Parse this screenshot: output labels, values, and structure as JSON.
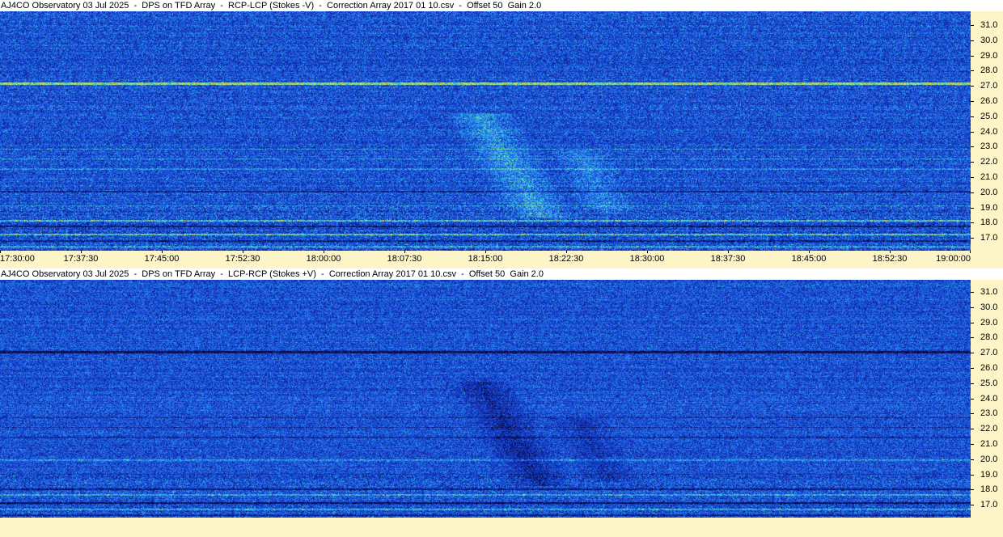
{
  "panels": [
    {
      "title": "AJ4CO Observatory 03 Jul 2025  -  DPS on TFD Array  -  RCP-LCP (Stokes -V)  -  Correction Array 2017 01 10.csv  -  Offset 50  Gain 2.0",
      "polarity": "positive"
    },
    {
      "title": "AJ4CO Observatory 03 Jul 2025  -  DPS on TFD Array  -  LCP-RCP (Stokes +V)  -  Correction Array 2017 01 10.csv  -  Offset 50  Gain 2.0",
      "polarity": "negative"
    }
  ],
  "freq_labels": [
    "31.0",
    "30.0",
    "29.0",
    "28.0",
    "27.0",
    "26.0",
    "25.0",
    "24.0",
    "23.0",
    "22.0",
    "21.0",
    "20.0",
    "19.0",
    "18.0",
    "17.0"
  ],
  "time_labels": [
    "17:30:00",
    "17:37:30",
    "17:45:00",
    "17:52:30",
    "18:00:00",
    "18:07:30",
    "18:15:00",
    "18:22:30",
    "18:30:00",
    "18:37:30",
    "18:45:00",
    "18:52:30",
    "19:00:00"
  ],
  "colors": {
    "background_blue": "#1b4fd6",
    "axis_bg": "#fdf5c8"
  }
}
